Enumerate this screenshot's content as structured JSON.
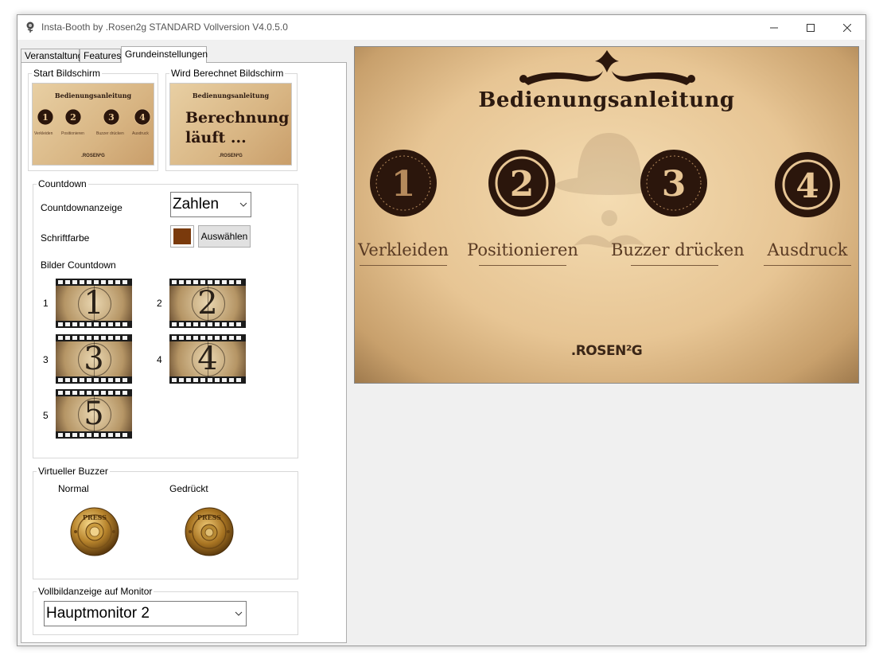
{
  "window": {
    "title": "Insta-Booth by .Rosen2g STANDARD Vollversion V4.0.5.0"
  },
  "tabs": [
    {
      "label": "Veranstaltung"
    },
    {
      "label": "Features"
    },
    {
      "label": "Grundeinstellungen"
    }
  ],
  "start_screen": {
    "legend": "Start Bildschirm",
    "thumb_title": "Bedienungsanleitung",
    "thumb_labels": [
      "Verkleiden",
      "Positionieren",
      "Buzzer drücken",
      "Ausdruck"
    ],
    "thumb_logo": ".ROSEN²G"
  },
  "calc_screen": {
    "legend": "Wird Berechnet Bildschirm",
    "thumb_title": "Bedienungsanleitung",
    "thumb_text_line1": "Berechnung",
    "thumb_text_line2": "läuft ...",
    "thumb_logo": ".ROSEN²G"
  },
  "countdown": {
    "legend": "Countdown",
    "display_label": "Countdownanzeige",
    "display_value": "Zahlen",
    "font_color_label": "Schriftfarbe",
    "font_color": "#7a3a0c",
    "choose_button": "Auswählen",
    "images_label": "Bilder Countdown",
    "images": [
      {
        "index": "1",
        "digit": "1"
      },
      {
        "index": "2",
        "digit": "2"
      },
      {
        "index": "3",
        "digit": "3"
      },
      {
        "index": "4",
        "digit": "4"
      },
      {
        "index": "5",
        "digit": "5"
      }
    ]
  },
  "buzzer": {
    "legend": "Virtueller Buzzer",
    "normal_label": "Normal",
    "pressed_label": "Gedrückt",
    "button_text": "PRESS"
  },
  "monitor": {
    "legend": "Vollbildanzeige auf Monitor",
    "value": "Hauptmonitor 2"
  },
  "preview": {
    "title": "Bedienungsanleitung",
    "steps": [
      {
        "number": "1",
        "label": "Verkleiden"
      },
      {
        "number": "2",
        "label": "Positionieren"
      },
      {
        "number": "3",
        "label": "Buzzer drücken"
      },
      {
        "number": "4",
        "label": "Ausdruck"
      }
    ],
    "logo": ".ROSEN²G"
  },
  "colors": {
    "seal_dark": "#2b160c",
    "paper": "#e7c594"
  }
}
